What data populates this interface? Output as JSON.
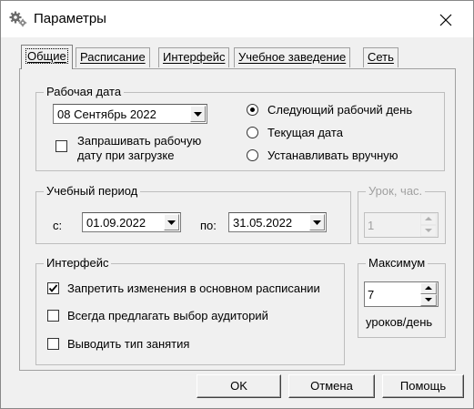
{
  "window": {
    "title": "Параметры",
    "icon": "gears-icon"
  },
  "tabs": [
    {
      "label": "Общие",
      "active": true
    },
    {
      "label": "Расписание"
    },
    {
      "label": "Интерфейс"
    },
    {
      "label": "Учебное заведение"
    },
    {
      "label": "Сеть"
    }
  ],
  "work_date": {
    "title": "Рабочая дата",
    "date_value": "08 Сентябрь 2022",
    "ask_on_load_line1": "Запрашивать рабочую",
    "ask_on_load_line2": "дату при загрузке",
    "ask_on_load_checked": false,
    "options": [
      "Следующий рабочий день",
      "Текущая дата",
      "Устанавливать вручную"
    ],
    "selected_option": 0
  },
  "study_period": {
    "title": "Учебный период",
    "from_label": "с:",
    "from_value": "01.09.2022",
    "to_label": "по:",
    "to_value": "31.05.2022"
  },
  "lesson_hours": {
    "title": "Урок, час.",
    "value": "1",
    "enabled": false
  },
  "interface": {
    "title": "Интерфейс",
    "items": [
      {
        "label": "Запретить изменения в основном расписании",
        "checked": true
      },
      {
        "label": "Всегда предлагать выбор аудиторий",
        "checked": false
      },
      {
        "label": "Выводить тип занятия",
        "checked": false
      }
    ]
  },
  "maximum": {
    "title": "Максимум",
    "value": "7",
    "unit": "уроков/день"
  },
  "buttons": {
    "ok": "OK",
    "cancel": "Отмена",
    "help": "Помощь"
  }
}
